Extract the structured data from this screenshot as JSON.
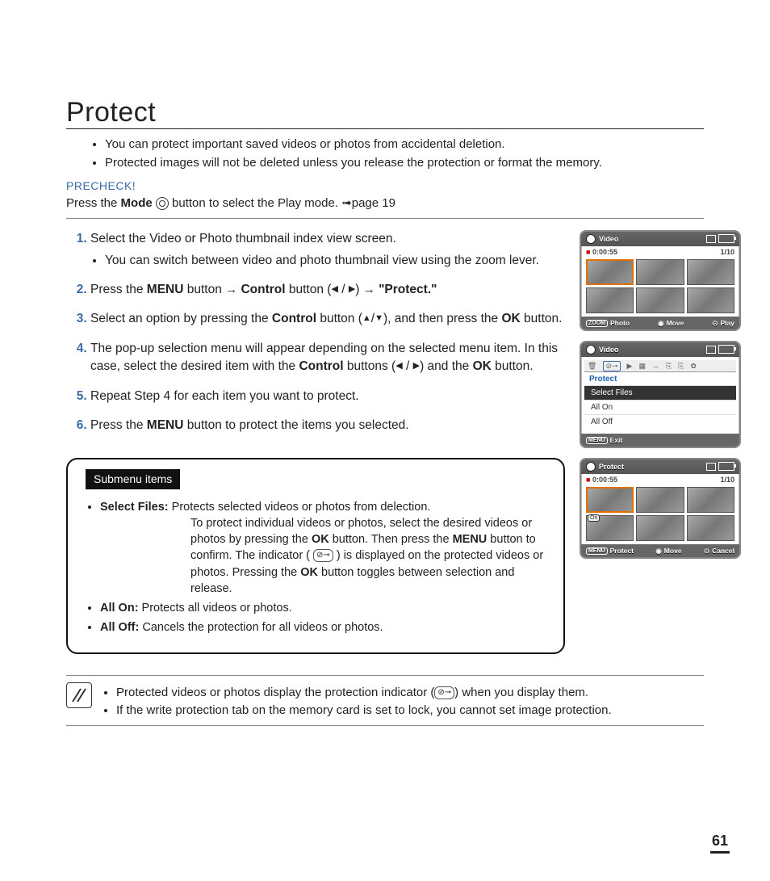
{
  "title": "Protect",
  "intro": [
    "You can protect important saved videos or photos from accidental deletion.",
    "Protected images will not be deleted unless you release the protection or format the memory."
  ],
  "precheck_label": "PRECHECK!",
  "precheck_pre": "Press the ",
  "precheck_mode": "Mode",
  "precheck_post": " button to select the Play mode. ",
  "precheck_ref": "page 19",
  "steps": {
    "s1": {
      "text": "Select the Video or Photo thumbnail index view screen.",
      "sub": "You can switch between video and photo thumbnail view using the zoom lever."
    },
    "s2": {
      "a": "Press the ",
      "menu": "MENU",
      "b": " button ",
      "control": "Control",
      "c": " button (",
      "d": ") ",
      "protect": "\"Protect.\""
    },
    "s3": {
      "a": "Select an option by pressing the ",
      "control": "Control",
      "b": " button (",
      "c": "), and then press the ",
      "ok": "OK",
      "d": " button."
    },
    "s4": {
      "a": "The pop-up selection menu will appear depending on the selected menu item. In this case, select the desired item with the ",
      "control": "Control",
      "b": " buttons (",
      "c": ") and the ",
      "ok": "OK",
      "d": " button."
    },
    "s5": "Repeat Step 4 for each item you want to protect.",
    "s6": {
      "a": "Press the ",
      "menu": "MENU",
      "b": " button to protect the items you selected."
    }
  },
  "submenu": {
    "title": "Submenu items",
    "sf_label": "Select Files:",
    "sf_line1": "Protects selected videos or photos from delection.",
    "sf_body_a": "To protect individual videos or photos, select the desired videos or photos by pressing the ",
    "ok": "OK",
    "sf_body_b": " button. Then press the ",
    "menu": "MENU",
    "sf_body_c": " button to confirm. The indicator ( ",
    "sf_body_d": " ) is displayed on the protected videos or photos. Pressing the ",
    "sf_body_e": " button toggles between selection and release.",
    "all_on_label": "All On:",
    "all_on_text": " Protects all videos or photos.",
    "all_off_label": "All Off:",
    "all_off_text": " Cancels the protection for all videos or photos."
  },
  "notes": {
    "n1a": "Protected videos or photos display the protection indicator (",
    "n1b": ") when you display them.",
    "n2": "If the write protection tab on the memory card is set to lock, you cannot set image protection."
  },
  "screens": {
    "s1": {
      "title": "Video",
      "time": "0:00:55",
      "count": "1/10",
      "bot_photo": "Photo",
      "bot_move": "Move",
      "bot_play": "Play",
      "zoom": "ZOOM"
    },
    "s2": {
      "title": "Video",
      "menu_label": "Protect",
      "opt1": "Select Files",
      "opt2": "All On",
      "opt3": "All Off",
      "exit": "Exit",
      "menu_btn": "MENU"
    },
    "s3": {
      "title": "Protect",
      "time": "0:00:55",
      "count": "1/10",
      "tag": "On",
      "bot_protect": "Protect",
      "bot_move": "Move",
      "bot_cancel": "Cancel",
      "menu_btn": "MENU"
    }
  },
  "page_number": "61",
  "icons": {
    "lock": "⊘⊸",
    "ring": "◉"
  }
}
